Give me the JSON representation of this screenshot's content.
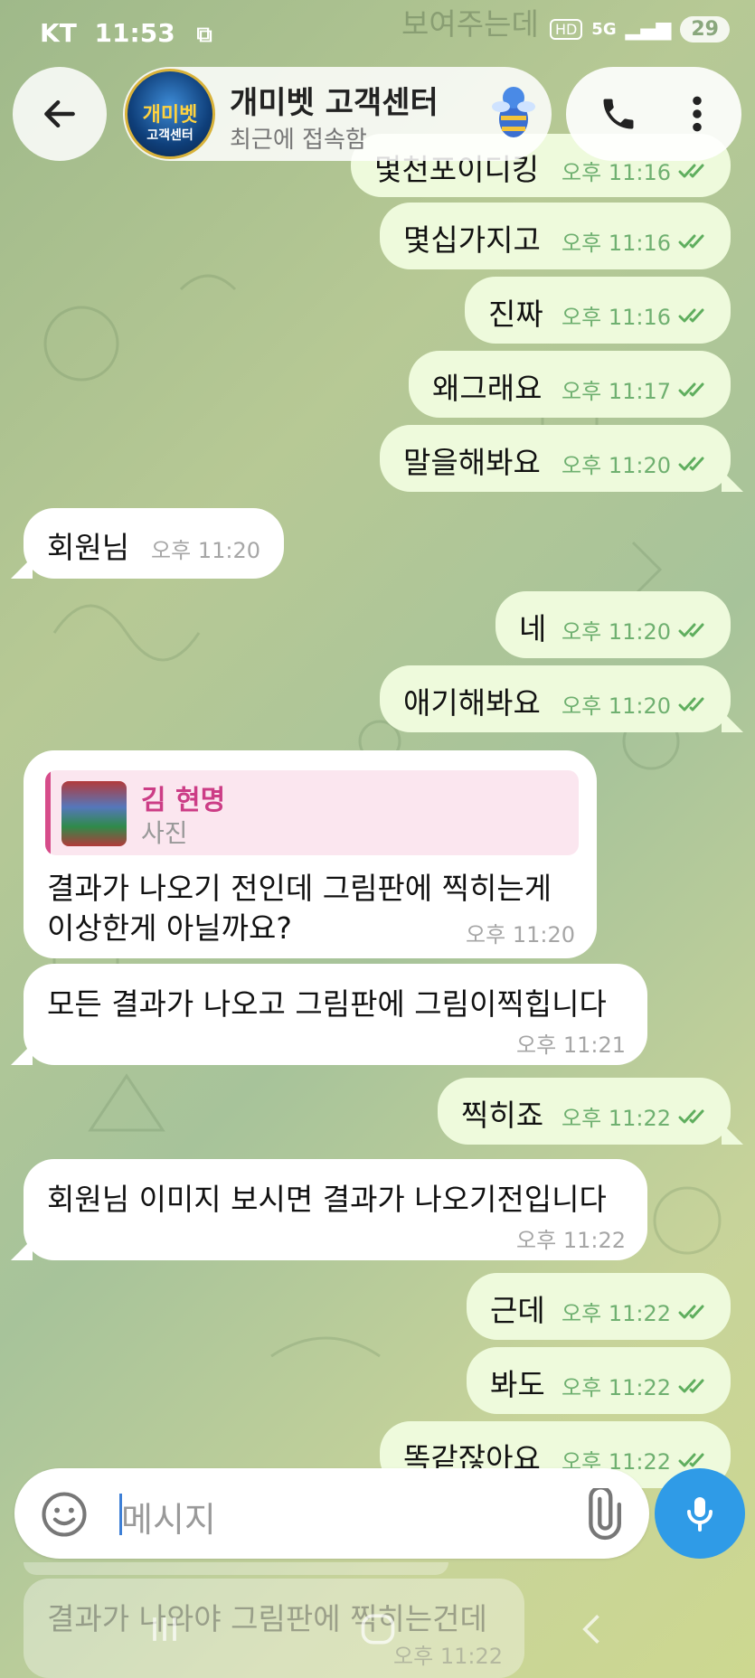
{
  "status_bar": {
    "carrier": "KT",
    "time": "11:53",
    "network": "5G",
    "badge": "HD",
    "battery": "29"
  },
  "header": {
    "title": "개미벳 고객센터",
    "subtitle": "최근에 접속함",
    "avatar_text": "개미벳",
    "avatar_sub": "고객센터"
  },
  "ghost_top": {
    "text": "보여주는데"
  },
  "messages": [
    {
      "dir": "out",
      "text": "몇천포이디킹",
      "time": "오후 11:16"
    },
    {
      "dir": "out",
      "text": "몇십가지고",
      "time": "오후 11:16"
    },
    {
      "dir": "out",
      "text": "진짜",
      "time": "오후 11:16"
    },
    {
      "dir": "out",
      "text": "왜그래요",
      "time": "오후 11:17"
    },
    {
      "dir": "out",
      "text": "말을해봐요",
      "time": "오후 11:20"
    },
    {
      "dir": "in",
      "text": "회원님",
      "time": "오후 11:20"
    },
    {
      "dir": "out",
      "text": "네",
      "time": "오후 11:20"
    },
    {
      "dir": "out",
      "text": "애기해봐요",
      "time": "오후 11:20"
    },
    {
      "dir": "in",
      "reply_name": "김 현명",
      "reply_type": "사진",
      "line1": "결과가 나오기 전인데 그림판에 찍히는게",
      "line2": "이상한게 아닐까요?",
      "time": "오후 11:20"
    },
    {
      "dir": "in",
      "text": "모든 결과가 나오고 그림판에 그림이찍힙니다",
      "time": "오후 11:21"
    },
    {
      "dir": "out",
      "text": "찍히죠",
      "time": "오후 11:22"
    },
    {
      "dir": "in",
      "text": "회원님 이미지 보시면 결과가 나오기전입니다",
      "time": "오후 11:22"
    },
    {
      "dir": "out",
      "text": "근데",
      "time": "오후 11:22"
    },
    {
      "dir": "out",
      "text": "봐도",
      "time": "오후 11:22"
    },
    {
      "dir": "out",
      "text": "똑같잖아요",
      "time": "오후 11:22"
    }
  ],
  "input": {
    "placeholder": "메시지"
  },
  "ghost_bottom": {
    "text": "결과가 나와야 그림판에 찍히는건데",
    "time": "오후 11:22"
  },
  "colors": {
    "outgoing_bubble": "#eefadc",
    "incoming_bubble": "#ffffff",
    "check": "#5fae5e",
    "mic": "#2f9be7",
    "reply_accent": "#d64c8a"
  }
}
